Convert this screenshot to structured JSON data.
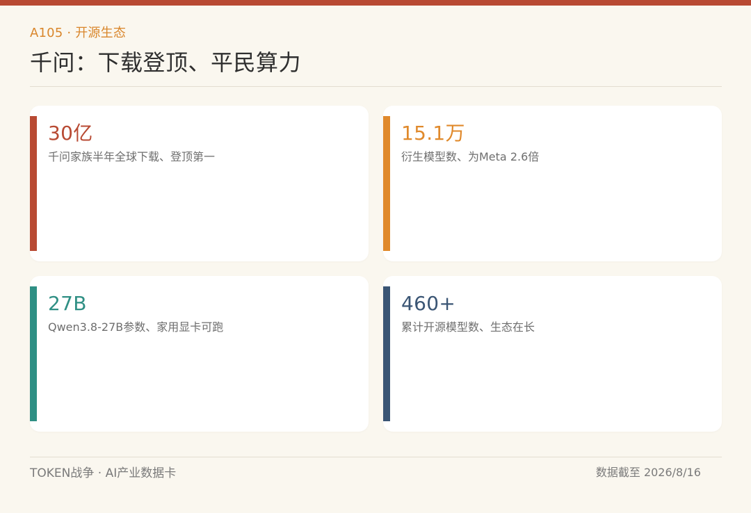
{
  "header": {
    "eyebrow": "A105 · 开源生态",
    "title": "千问：下载登顶、平民算力"
  },
  "cards": [
    {
      "value": "30亿",
      "description": "千问家族半年全球下载、登顶第一",
      "accent_color": "#b84a33",
      "value_color": "#b84a33"
    },
    {
      "value": "15.1万",
      "description": "衍生模型数、为Meta 2.6倍",
      "accent_color": "#e0892b",
      "value_color": "#e0892b"
    },
    {
      "value": "27B",
      "description": "Qwen3.8-27B参数、家用显卡可跑",
      "accent_color": "#2f8f84",
      "value_color": "#2f8f84"
    },
    {
      "value": "460+",
      "description": "累计开源模型数、生态在长",
      "accent_color": "#3a5574",
      "value_color": "#3a5574"
    }
  ],
  "footer": {
    "left": "TOKEN战争 · AI产业数据卡",
    "right": "数据截至 2026/8/16"
  },
  "colors": {
    "background": "#faf7ef",
    "top_bar": "#b84a33",
    "eyebrow": "#d9862b",
    "divider": "#e3ddd0"
  }
}
